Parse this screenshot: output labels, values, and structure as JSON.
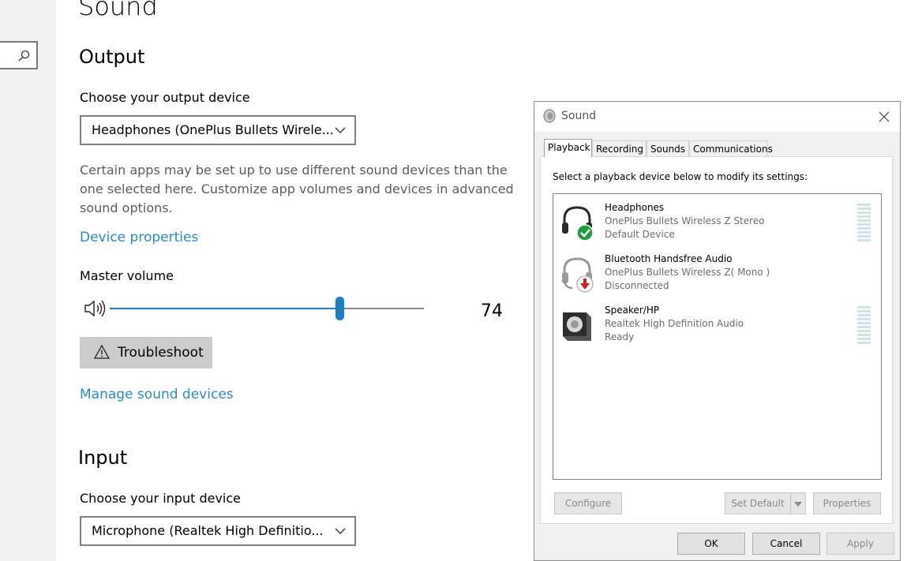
{
  "settings": {
    "page_title": "Sound",
    "output": {
      "heading": "Output",
      "device_label": "Choose your output device",
      "device_value": "Headphones (OnePlus Bullets Wirele...",
      "description": "Certain apps may be set up to use different sound devices than the one selected here. Customize app volumes and devices in advanced sound options.",
      "device_properties_link": "Device properties",
      "master_volume_label": "Master volume",
      "volume_value": "74",
      "troubleshoot_label": "Troubleshoot",
      "manage_link": "Manage sound devices"
    },
    "input": {
      "heading": "Input",
      "device_label": "Choose your input device",
      "device_value": "Microphone (Realtek High Definitio..."
    }
  },
  "dialog": {
    "title": "Sound",
    "tabs": [
      "Playback",
      "Recording",
      "Sounds",
      "Communications"
    ],
    "instruction": "Select a playback device below to modify its settings:",
    "devices": [
      {
        "name": "Headphones",
        "sub": "OnePlus Bullets Wireless Z Stereo",
        "status": "Default Device"
      },
      {
        "name": "Bluetooth Handsfree Audio",
        "sub": "OnePlus Bullets Wireless Z( Mono )",
        "status": "Disconnected"
      },
      {
        "name": "Speaker/HP",
        "sub": "Realtek High Definition Audio",
        "status": "Ready"
      }
    ],
    "buttons": {
      "configure": "Configure",
      "set_default": "Set Default",
      "properties": "Properties",
      "ok": "OK",
      "cancel": "Cancel",
      "apply": "Apply"
    }
  },
  "colors": {
    "accent": "#1a7fc4",
    "link": "#2a8bc6",
    "ok_green": "#1e9e3a",
    "disconnect_red": "#d42020"
  }
}
